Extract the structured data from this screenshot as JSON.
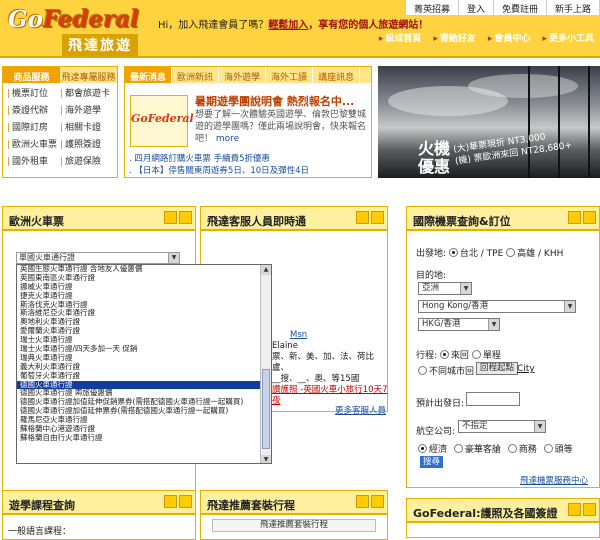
{
  "header": {
    "logo_go": "Go",
    "logo_federal": "Federal",
    "logo_cn": "飛達旅遊",
    "welcome_prefix": "Hi，加入飛達會員了嗎？",
    "join_link": "輕鬆加入",
    "welcome_suffix": "，享有您的個人旅遊網站！",
    "top_links": [
      "菁英招募",
      "登入",
      "免費註冊",
      "新手上路"
    ],
    "sub_nav": [
      "設成首頁",
      "寄給好友",
      "會員中心",
      "更多小工具"
    ]
  },
  "service": {
    "tabs": [
      "商品服務",
      "飛達專屬服務"
    ],
    "items": [
      "機票訂位",
      "都會旅遊卡",
      "簽證代辦",
      "海外遊學",
      "國際訂房",
      "相關卡證",
      "歐洲火車票",
      "護照簽證",
      "國外租車",
      "旅遊保險"
    ]
  },
  "news": {
    "tabs": [
      "最新消息",
      "歐洲新訊",
      "海外遊學",
      "海外工讀",
      "講座訊息"
    ],
    "logo_text": "GoFederal",
    "headline": "暑期遊學團說明會 熱烈報名中...",
    "desc": "想要了解一次體驗英國遊學、倫敦巴黎雙城遊的遊學團嗎？僅此兩場說明會，快來報名吧！",
    "more": "more",
    "items": [
      ". 四月網路訂購火車票 手續費5折優惠",
      ". 【日本】停售關東周遊券5日、10日及彈性4日"
    ]
  },
  "banner": {
    "title_line1": "火機",
    "title_line2": "優惠",
    "deal_line1": "(大)華票現折 NT3,000",
    "deal_line2": "(機) 票歐洲來回 NT28,680+"
  },
  "rail": {
    "title": "歐洲火車票",
    "selected": "單國火車通行證",
    "options": [
      "英國生態火車通行證 含地友人優惠價",
      "英國東南區火車通行證",
      "挪威火車通行證",
      "捷克火車通行證",
      "斯洛伐克火車通行證",
      "斯洛維尼亞火車通行證",
      "奧地利火車通行證",
      "愛爾蘭火車通行證",
      "瑞士火車通行證",
      "瑞士火車通行證/四天多加一天 促銷",
      "瑞典火車通行證",
      "義大利火車通行證",
      "葡萄牙火車通行證",
      "德國火車通行證",
      "德國火車通行證 兩旅優惠價",
      "德國火車通行證加值延伸促銷票券(需搭配德國火車通行證一起購買)",
      "德國火車通行證加值延伸票券(需搭配德國火車通行證一起購買)",
      "羅馬尼亞火車通行證",
      "蘇格蘭中心港遊通行證",
      "蘇格蘭自由行火車通行證"
    ],
    "selected_index": 13
  },
  "cs": {
    "title": "飛達客服人員即時通",
    "msn": "Msn",
    "line2": "Elaine",
    "line3": "票、新、美、加、法、荷比盧、",
    "line4": "__搜、__、奧、等15國",
    "promo": "讚護照 -英國火車小旅行10天7夜",
    "more": "更多客服人員"
  },
  "air": {
    "title": "國際機票查詢&訂位",
    "depart_label": "出發地:",
    "depart_opts": [
      "台北 / TPE",
      "高雄 / KHH"
    ],
    "dest_label": "目的地:",
    "region": "亞洲",
    "city": "Hong Kong/香港",
    "airport": "HKG/香港",
    "trip_label": "行程:",
    "trip_opts": [
      "來回",
      "單程"
    ],
    "multi": "不同城市回",
    "return_btn": "回程起點",
    "city_link": "City",
    "date_label": "預計出發日:",
    "airline_label": "航空公司:",
    "airline": "不指定",
    "cabin_opts": [
      "經濟",
      "豪華客艙",
      "商務",
      "頭等"
    ],
    "query_btn": "搜尋",
    "more": "飛達機票服務中心"
  },
  "tour": {
    "title": "遊學課程查詢",
    "label": "一般語言課程："
  },
  "pkg": {
    "title": "飛達推薦套裝行程",
    "label": "飛達推薦套裝行程"
  },
  "visa": {
    "title": "GoFederal:護照及各國簽證"
  }
}
